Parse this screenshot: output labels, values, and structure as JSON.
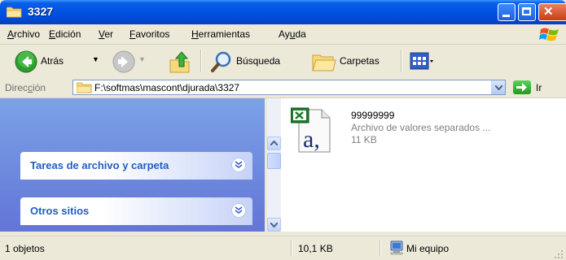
{
  "window": {
    "title": "3327"
  },
  "menu": {
    "items": [
      {
        "pre": "",
        "u": "A",
        "post": "rchivo"
      },
      {
        "pre": "",
        "u": "E",
        "post": "dición"
      },
      {
        "pre": "",
        "u": "V",
        "post": "er"
      },
      {
        "pre": "",
        "u": "F",
        "post": "avoritos"
      },
      {
        "pre": "",
        "u": "H",
        "post": "erramientas"
      },
      {
        "pre": "Ay",
        "u": "u",
        "post": "da"
      }
    ]
  },
  "toolbar": {
    "back_label": "Atrás",
    "search_label": "Búsqueda",
    "folders_label": "Carpetas"
  },
  "address": {
    "label_pre": "Direc",
    "label_u": "c",
    "label_post": "ión",
    "path": "F:\\softmas\\mascont\\djurada\\3327",
    "go_label": "Ir"
  },
  "taskpane": {
    "panels": [
      {
        "title": "Tareas de archivo y carpeta"
      },
      {
        "title": "Otros sitios"
      }
    ]
  },
  "file": {
    "name": "99999999",
    "type": "Archivo de valores separados ...",
    "size": "11 KB"
  },
  "status": {
    "objects": "1 objetos",
    "size": "10,1 KB",
    "location": "Mi equipo"
  },
  "colors": {
    "titlebar": "#0054E3",
    "taskpane": "#6F8FE0",
    "panel_title": "#215DC6"
  }
}
